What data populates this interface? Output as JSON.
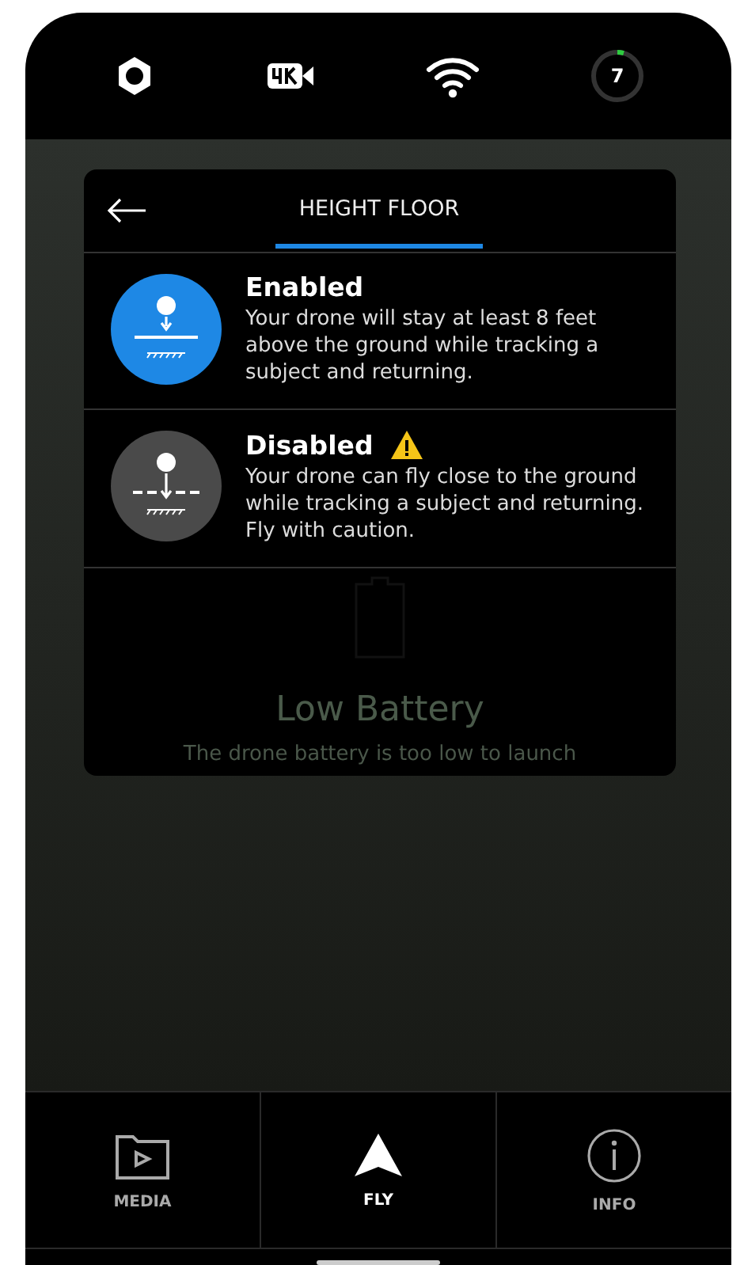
{
  "status_bar": {
    "counter": "7"
  },
  "dialog": {
    "title": "HEIGHT FLOOR",
    "options": [
      {
        "title": "Enabled",
        "description": "Your drone will stay at least 8 feet above the ground while tracking a subject and returning.",
        "selected": true,
        "warning": false
      },
      {
        "title": "Disabled",
        "description": "Your drone can fly close to the ground while tracking a subject and returning. Fly with caution.",
        "selected": false,
        "warning": true
      }
    ],
    "background_message": {
      "title": "Low Battery",
      "text": "The drone battery is too low to launch"
    }
  },
  "tabs": [
    {
      "label": "MEDIA",
      "kind": "media",
      "selected": false
    },
    {
      "label": "FLY",
      "kind": "fly",
      "selected": true
    },
    {
      "label": "INFO",
      "kind": "info",
      "selected": false
    }
  ]
}
